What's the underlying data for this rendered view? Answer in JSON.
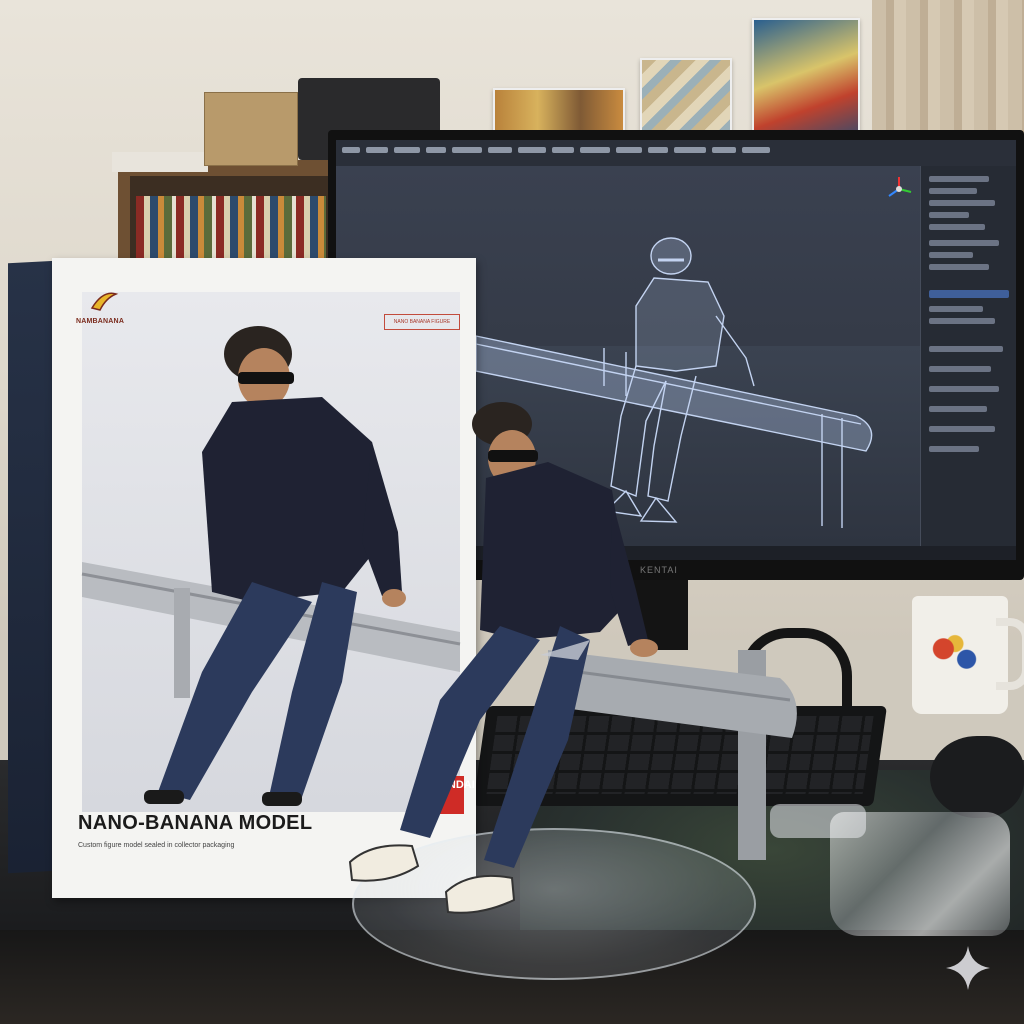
{
  "box": {
    "title": "NANO-BANANA MODEL",
    "brand_badge": "BANDAI",
    "logo_text": "NAMBANANA",
    "tag_text": "NANO BANANA FIGURE",
    "subtitle": "Custom figure model sealed in collector packaging"
  },
  "monitor": {
    "brand": "KENTAI"
  },
  "icons": [
    "banana-logo-icon",
    "sparkle-icon",
    "axis-gizmo-icon"
  ],
  "colors": {
    "box_badge": "#cf2b26",
    "screen_bg": "#2f3644",
    "wireframe": "#cfe0ff",
    "shirt": "#1f2233",
    "jeans": "#2c3a5c"
  }
}
